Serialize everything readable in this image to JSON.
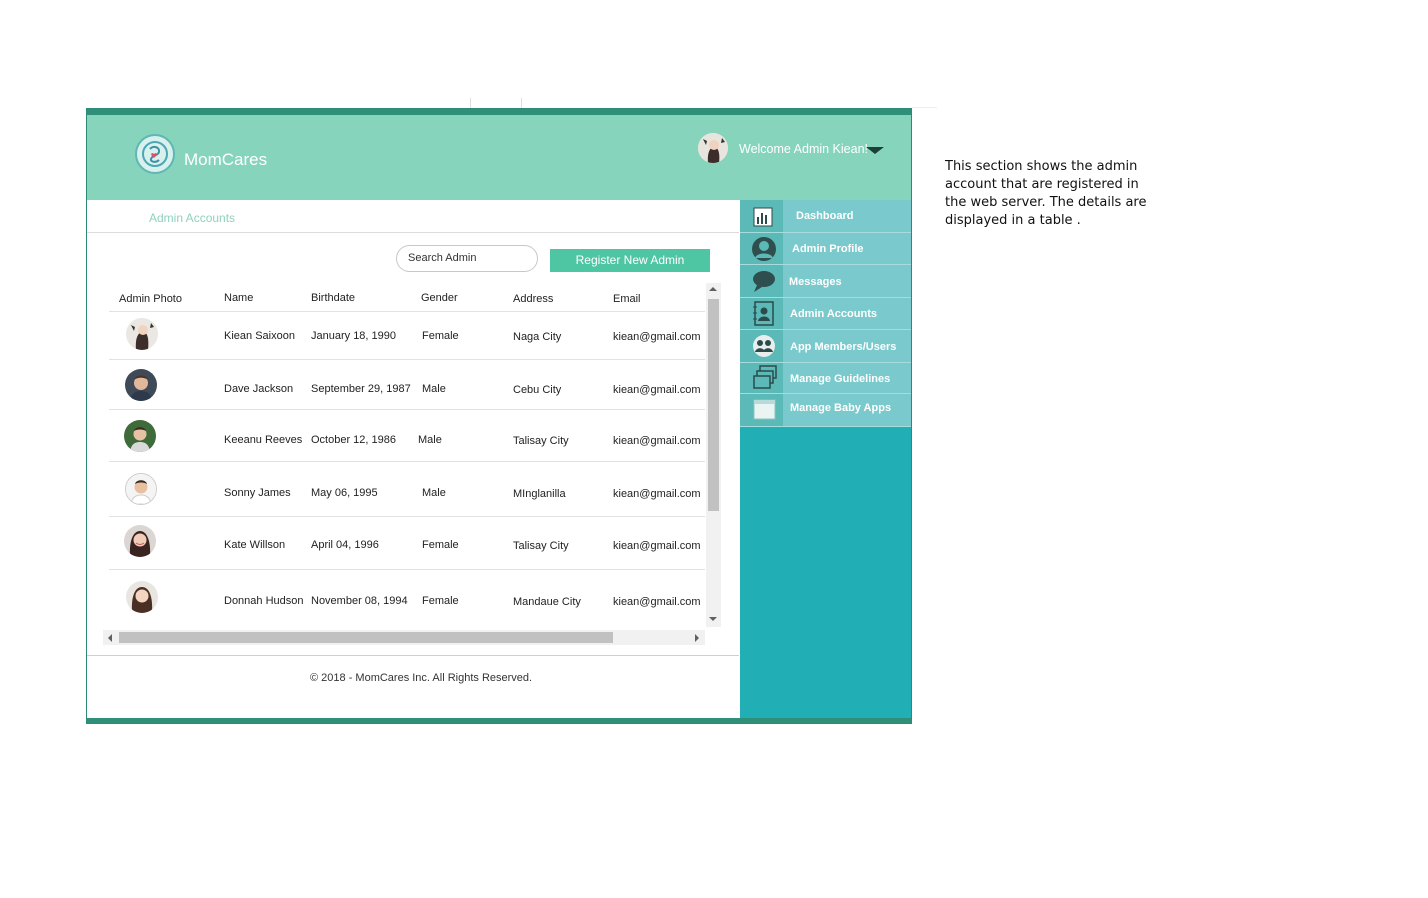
{
  "app": {
    "brand": "MomCares",
    "welcome": "Welcome Admin Kiean!"
  },
  "breadcrumb": "Admin Accounts",
  "search": {
    "placeholder": "Search Admin"
  },
  "register_button": "Register New Admin",
  "table": {
    "headers": [
      "Admin Photo",
      "Name",
      "Birthdate",
      "Gender",
      "Address",
      "Email"
    ],
    "rows": [
      {
        "name": "Kiean Saixoon",
        "birthdate": "January 18, 1990",
        "gender": "Female",
        "address": "Naga City",
        "email": "kiean@gmail.com"
      },
      {
        "name": "Dave Jackson",
        "birthdate": "September 29, 1987",
        "gender": "Male",
        "address": "Cebu City",
        "email": "kiean@gmail.com"
      },
      {
        "name": "Keeanu Reeves",
        "birthdate": "October 12, 1986",
        "gender": "Male",
        "address": "Talisay City",
        "email": "kiean@gmail.com"
      },
      {
        "name": "Sonny James",
        "birthdate": "May 06, 1995",
        "gender": "Male",
        "address": "MInglanilla",
        "email": "kiean@gmail.com"
      },
      {
        "name": "Kate Willson",
        "birthdate": "April 04, 1996",
        "gender": "Female",
        "address": "Talisay City",
        "email": "kiean@gmail.com"
      },
      {
        "name": "Donnah Hudson",
        "birthdate": "November 08, 1994",
        "gender": "Female",
        "address": "Mandaue City",
        "email": "kiean@gmail.com"
      }
    ]
  },
  "footer": "© 2018 - MomCares Inc. All Rights Reserved.",
  "sidebar": {
    "items": [
      {
        "label": "Dashboard",
        "icon": "bar-chart-icon"
      },
      {
        "label": "Admin Profile",
        "icon": "profile-icon"
      },
      {
        "label": "Messages",
        "icon": "chat-bubble-icon"
      },
      {
        "label": "Admin Accounts",
        "icon": "contact-book-icon"
      },
      {
        "label": "App Members/Users",
        "icon": "users-group-icon"
      },
      {
        "label": "Manage Guidelines",
        "icon": "stacked-windows-icon"
      },
      {
        "label": "Manage Baby Apps",
        "icon": "window-icon"
      }
    ]
  },
  "annotation": "This section shows the admin account that are registered in the web server. The details are displayed in a table .",
  "colors": {
    "header": "#85d4bb",
    "accent": "#4ec5a3",
    "sidebar": "#21aeb4",
    "nav_item": "#7ac9cc"
  }
}
